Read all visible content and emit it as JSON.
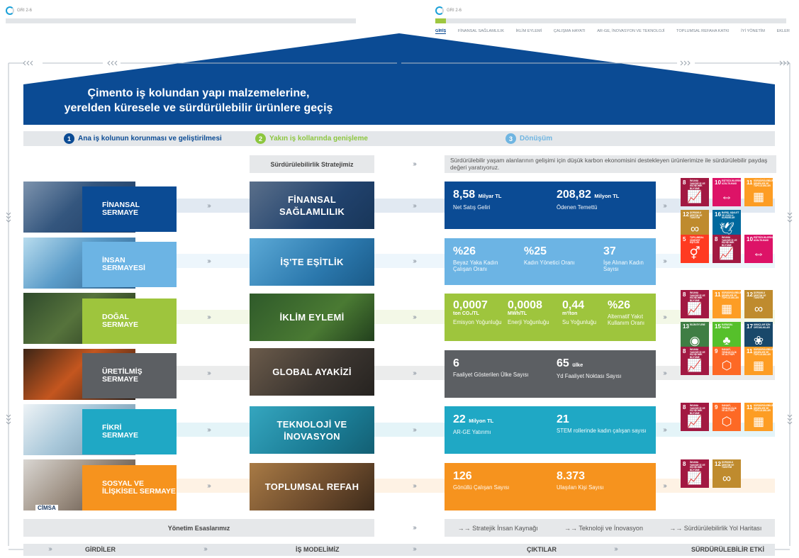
{
  "header": {
    "left_tag": "GRI 2-6",
    "right_tag": "GRI 2-6",
    "nav": [
      "GİRİŞ",
      "FİNANSAL SAĞLAMLILIK",
      "İKLİM EYLEMİ",
      "ÇALIŞMA HAYATI",
      "AR-GE, İNOVASYON VE TEKNOLOJİ",
      "TOPLUMSAL REFAHA KATKI",
      "İYİ YÖNETİM",
      "EKLER"
    ]
  },
  "banner": {
    "line1": "Çimento iş kolundan yapı malzemelerine,",
    "line2": "yerelden küresele ve sürdürülebilir ürünlere geçiş"
  },
  "steps": [
    {
      "num": "1",
      "label": "Ana iş kolunun korunması ve geliştirilmesi",
      "color": "#0b4b94"
    },
    {
      "num": "2",
      "label": "Yakın iş kollarında genişleme",
      "color": "#8cc63e"
    },
    {
      "num": "3",
      "label": "Dönüşüm",
      "color": "#6fb5e1"
    }
  ],
  "strategy_label": "Sürdürülebilirlik Stratejimiz",
  "strategy_text": "Sürdürülebilir yaşam alanlarının gelişimi için düşük karbon ekonomisini destekleyen ürünlerimize ile sürdürülebilir paydaş değeri yaratıyoruz.",
  "rows": [
    {
      "input": [
        "FİNANSAL",
        "SERMAYE"
      ],
      "model": [
        "FİNANSAL",
        "SAĞLAMLILIK"
      ],
      "color": "#0b4b94",
      "stats": [
        {
          "value": "8,58",
          "unit": "Milyar TL",
          "label": "Net Satış Geliri"
        },
        {
          "value": "208,82",
          "unit": "Milyon TL",
          "label": "Ödenen Temettü"
        }
      ],
      "sdgs": [
        {
          "n": "8",
          "t": "İNSANA YAKIŞIR İŞ VE EKONOMİK BÜYÜME",
          "c": "#a21942",
          "g": "📈"
        },
        {
          "n": "10",
          "t": "EŞİTSİZLİKLERİN AZALTILMASI",
          "c": "#dd1367",
          "g": "⇔"
        },
        {
          "n": "11",
          "t": "SÜRDÜRÜLEBİLİR ŞEHİRLER VE TOPLULUKLAR",
          "c": "#fd9d24",
          "g": "▦"
        },
        {
          "n": "12",
          "t": "SORUMLU ÜRETİM VE TÜKETİM",
          "c": "#bf8b2e",
          "g": "∞"
        },
        {
          "n": "16",
          "t": "BARIŞ, ADALET VE GÜÇLÜ KURUMLAR",
          "c": "#00689d",
          "g": "🕊"
        }
      ]
    },
    {
      "input": [
        "İNSAN",
        "SERMAYESİ"
      ],
      "model": [
        "İŞ'TE EŞİTLİK"
      ],
      "color": "#6cb4e4",
      "stats": [
        {
          "value": "%26",
          "unit": "",
          "label": "Beyaz Yaka Kadın Çalışan Oranı"
        },
        {
          "value": "%25",
          "unit": "",
          "label": "Kadın Yönetici Oranı"
        },
        {
          "value": "37",
          "unit": "",
          "label": "İşe Alınan Kadın Sayısı"
        }
      ],
      "sdgs": [
        {
          "n": "5",
          "t": "TOPLUMSAL CİNSİYET EŞİTLİĞİ",
          "c": "#ff3a21",
          "g": "⚥"
        },
        {
          "n": "8",
          "t": "İNSANA YAKIŞIR İŞ VE EKONOMİK BÜYÜME",
          "c": "#a21942",
          "g": "📈"
        },
        {
          "n": "10",
          "t": "EŞİTSİZLİKLERİN AZALTILMASI",
          "c": "#dd1367",
          "g": "⇔"
        }
      ]
    },
    {
      "input": [
        "DOĞAL",
        "SERMAYE"
      ],
      "model": [
        "İKLİM EYLEMİ"
      ],
      "color": "#9ec53d",
      "stats": [
        {
          "value": "0,0007",
          "unit": "ton CO₂/TL",
          "label": "Emisyon Yoğunluğu"
        },
        {
          "value": "0,0008",
          "unit": "MWh/TL",
          "label": "Enerji Yoğunluğu"
        },
        {
          "value": "0,44",
          "unit": "m³/ton",
          "label": "Su Yoğunluğu"
        },
        {
          "value": "%26",
          "unit": "",
          "label": "Alternatif Yakıt Kullanım Oranı"
        }
      ],
      "sdgs": [
        {
          "n": "8",
          "t": "İNSANA YAKIŞIR İŞ VE EKONOMİK BÜYÜME",
          "c": "#a21942",
          "g": "📈"
        },
        {
          "n": "11",
          "t": "SÜRDÜRÜLEBİLİR ŞEHİRLER VE TOPLULUKLAR",
          "c": "#fd9d24",
          "g": "▦"
        },
        {
          "n": "12",
          "t": "SORUMLU ÜRETİM VE TÜKETİM",
          "c": "#bf8b2e",
          "g": "∞"
        },
        {
          "n": "13",
          "t": "İKLİM EYLEMİ",
          "c": "#3f7e44",
          "g": "◉"
        },
        {
          "n": "15",
          "t": "KARASAL YAŞAM",
          "c": "#56c02b",
          "g": "♣"
        },
        {
          "n": "17",
          "t": "AMAÇLAR İÇİN ORTAKLIKLAR",
          "c": "#19486a",
          "g": "❀"
        }
      ]
    },
    {
      "input": [
        "ÜRETİLMİŞ",
        "SERMAYE"
      ],
      "model": [
        "GLOBAL AYAKİZİ"
      ],
      "color": "#5c5f63",
      "stats": [
        {
          "value": "6",
          "unit": "",
          "label": "Faaliyet Gösterilen Ülke Sayısı"
        },
        {
          "value": "65",
          "unit": "ülke",
          "label": "Yd Faaliyet Noktası Sayısı"
        }
      ],
      "sdgs": [
        {
          "n": "8",
          "t": "İNSANA YAKIŞIR İŞ VE EKONOMİK BÜYÜME",
          "c": "#a21942",
          "g": "📈"
        },
        {
          "n": "9",
          "t": "SANAYİ, YENİLİKÇİLİK VE ALTYAPI",
          "c": "#fd6925",
          "g": "⬡"
        },
        {
          "n": "11",
          "t": "SÜRDÜRÜLEBİLİR ŞEHİRLER VE TOPLULUKLAR",
          "c": "#fd9d24",
          "g": "▦"
        }
      ]
    },
    {
      "input": [
        "FİKRİ",
        "SERMAYE"
      ],
      "model": [
        "TEKNOLOJİ VE",
        "İNOVASYON"
      ],
      "color": "#1fa8c5",
      "stats": [
        {
          "value": "22",
          "unit": "Milyon TL",
          "label": "AR-GE Yatırımı"
        },
        {
          "value": "21",
          "unit": "",
          "label": "STEM rollerinde kadın çalışan sayısı"
        }
      ],
      "sdgs": [
        {
          "n": "8",
          "t": "İNSANA YAKIŞIR İŞ VE EKONOMİK BÜYÜME",
          "c": "#a21942",
          "g": "📈"
        },
        {
          "n": "9",
          "t": "SANAYİ, YENİLİKÇİLİK VE ALTYAPI",
          "c": "#fd6925",
          "g": "⬡"
        },
        {
          "n": "11",
          "t": "SÜRDÜRÜLEBİLİR ŞEHİRLER VE TOPLULUKLAR",
          "c": "#fd9d24",
          "g": "▦"
        }
      ]
    },
    {
      "input": [
        "SOSYAL VE",
        "İLİŞKİSEL SERMAYE"
      ],
      "model": [
        "TOPLUMSAL REFAH"
      ],
      "color": "#f6931e",
      "stats": [
        {
          "value": "126",
          "unit": "",
          "label": "Gönüllü Çalışan Sayısı"
        },
        {
          "value": "8.373",
          "unit": "",
          "label": "Ulaşılan Kişi Sayısı"
        }
      ],
      "sdgs": [
        {
          "n": "8",
          "t": "İNSANA YAKIŞIR İŞ VE EKONOMİK BÜYÜME",
          "c": "#a21942",
          "g": "📈"
        },
        {
          "n": "12",
          "t": "SORUMLU ÜRETİM VE TÜKETİM",
          "c": "#bf8b2e",
          "g": "∞"
        }
      ]
    }
  ],
  "logo_text": "CİMSA",
  "governance_label": "Yönetim Esaslarımız",
  "governance_items": [
    "Stratejik İnsan Kaynağı",
    "Teknoloji ve İnovasyon",
    "Sürdürülebilirlik Yol Haritası"
  ],
  "bottom": [
    "GİRDİLER",
    "İŞ MODELİMİZ",
    "ÇIKTILAR",
    "SÜRDÜRÜLEBİLİR ETKİ"
  ],
  "colors": {
    "primary": "#0b4b94",
    "lightgray": "#e4e7ea"
  }
}
